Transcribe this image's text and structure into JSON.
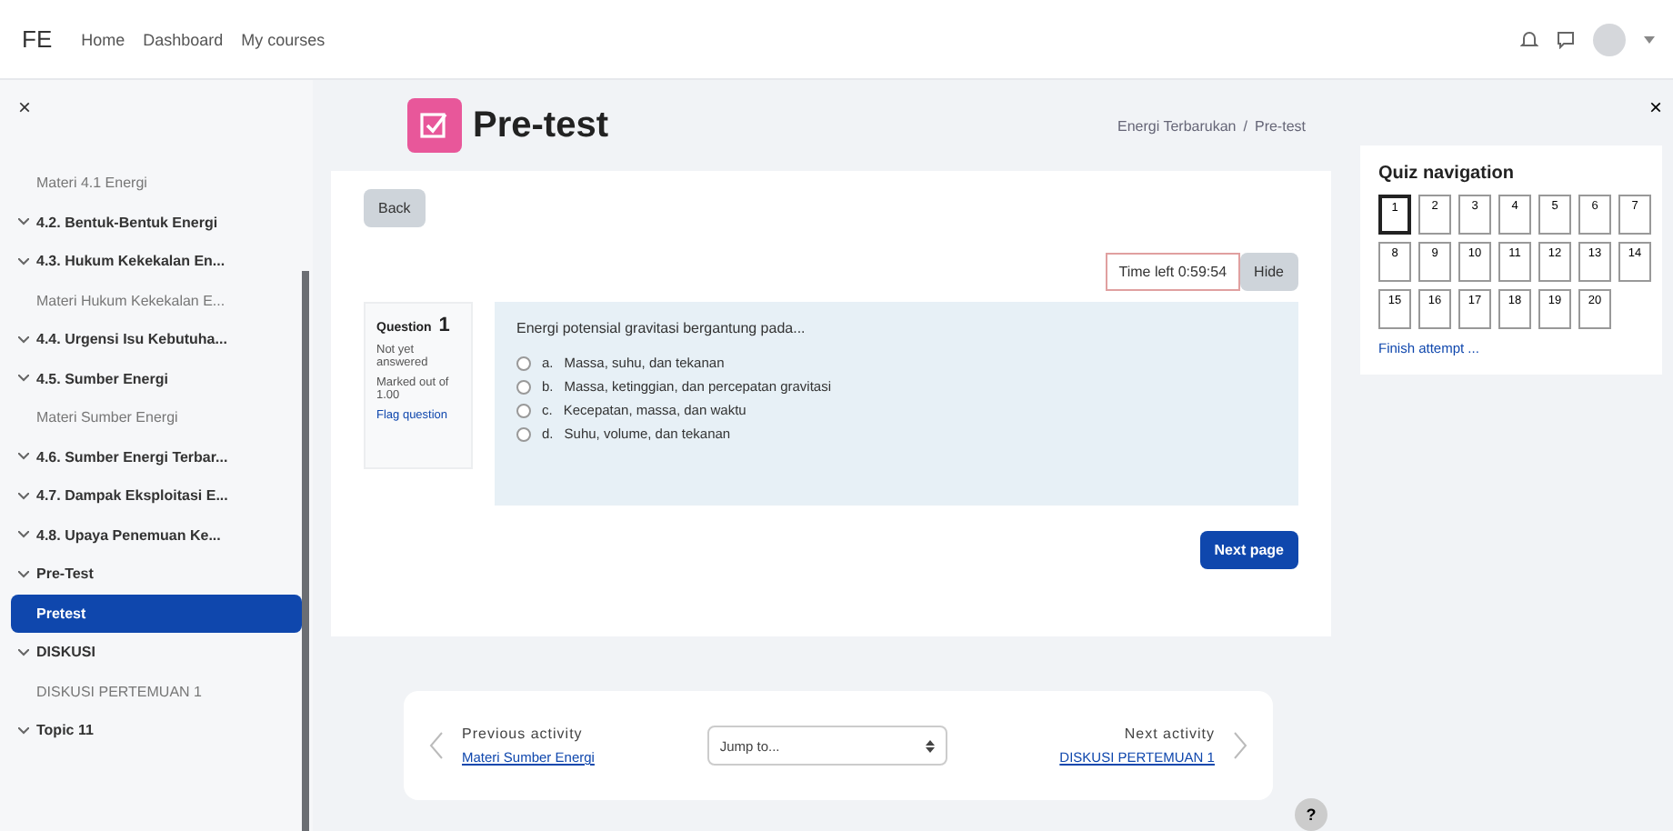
{
  "navbar": {
    "logo": "FE",
    "links": [
      "Home",
      "Dashboard",
      "My courses"
    ]
  },
  "sidebar": {
    "close": "×",
    "items": [
      {
        "kind": "activity",
        "label": "Materi 4.1 Energi",
        "selected": false
      },
      {
        "kind": "section",
        "label": "4.2. Bentuk-Bentuk Energi",
        "selected": false
      },
      {
        "kind": "section",
        "label": "4.3. Hukum Kekekalan En...",
        "selected": false
      },
      {
        "kind": "activity",
        "label": "Materi Hukum Kekekalan E...",
        "selected": false
      },
      {
        "kind": "section",
        "label": "4.4. Urgensi Isu Kebutuha...",
        "selected": false
      },
      {
        "kind": "section",
        "label": "4.5. Sumber Energi",
        "selected": false
      },
      {
        "kind": "activity",
        "label": "Materi Sumber Energi",
        "selected": false
      },
      {
        "kind": "section",
        "label": "4.6. Sumber Energi Terbar...",
        "selected": false
      },
      {
        "kind": "section",
        "label": "4.7. Dampak Eksploitasi E...",
        "selected": false
      },
      {
        "kind": "section",
        "label": "4.8. Upaya Penemuan Ke...",
        "selected": false
      },
      {
        "kind": "section",
        "label": "Pre-Test",
        "selected": false
      },
      {
        "kind": "activity",
        "label": "Pretest",
        "selected": true
      },
      {
        "kind": "section",
        "label": "DISKUSI",
        "selected": false
      },
      {
        "kind": "activity",
        "label": "DISKUSI PERTEMUAN 1",
        "selected": false
      },
      {
        "kind": "section",
        "label": "Topic 11",
        "selected": false
      }
    ]
  },
  "page": {
    "title": "Pre-test",
    "breadcrumb": {
      "items": [
        "Energi Terbarukan",
        "Pre-test"
      ],
      "separator": "/"
    },
    "back": "Back",
    "timer": "Time left 0:59:54",
    "hide": "Hide",
    "question": {
      "title": "Question",
      "number": "1",
      "status": "Not yet answered",
      "marks": "Marked out of 1.00",
      "flag": "Flag question",
      "text": "Energi potensial gravitasi bergantung pada...",
      "options": [
        {
          "letter": "a.",
          "text": "Massa, suhu, dan tekanan",
          "selected": false
        },
        {
          "letter": "b.",
          "text": "Massa, ketinggian, dan percepatan gravitasi",
          "selected": false
        },
        {
          "letter": "c.",
          "text": "Kecepatan, massa, dan waktu",
          "selected": false
        },
        {
          "letter": "d.",
          "text": "Suhu, volume, dan tekanan",
          "selected": false
        }
      ]
    },
    "next": "Next page"
  },
  "activity_nav": {
    "prev_label": "Previous activity",
    "prev_link": "Materi Sumber Energi",
    "jump": "Jump to...",
    "next_label": "Next activity",
    "next_link": "DISKUSI PERTEMUAN 1"
  },
  "help": "?",
  "quiz_nav": {
    "close": "×",
    "title": "Quiz navigation",
    "buttons": [
      {
        "label": "1",
        "selected": true
      },
      {
        "label": "2",
        "selected": false
      },
      {
        "label": "3",
        "selected": false
      },
      {
        "label": "4",
        "selected": false
      },
      {
        "label": "5",
        "selected": false
      },
      {
        "label": "6",
        "selected": false
      },
      {
        "label": "7",
        "selected": false
      },
      {
        "label": "8",
        "selected": false
      },
      {
        "label": "9",
        "selected": false
      },
      {
        "label": "10",
        "selected": false
      },
      {
        "label": "11",
        "selected": false
      },
      {
        "label": "12",
        "selected": false
      },
      {
        "label": "13",
        "selected": false
      },
      {
        "label": "14",
        "selected": false
      },
      {
        "label": "15",
        "selected": false
      },
      {
        "label": "16",
        "selected": false
      },
      {
        "label": "17",
        "selected": false
      },
      {
        "label": "18",
        "selected": false
      },
      {
        "label": "19",
        "selected": false
      },
      {
        "label": "20",
        "selected": false
      }
    ],
    "finish": "Finish attempt ..."
  }
}
